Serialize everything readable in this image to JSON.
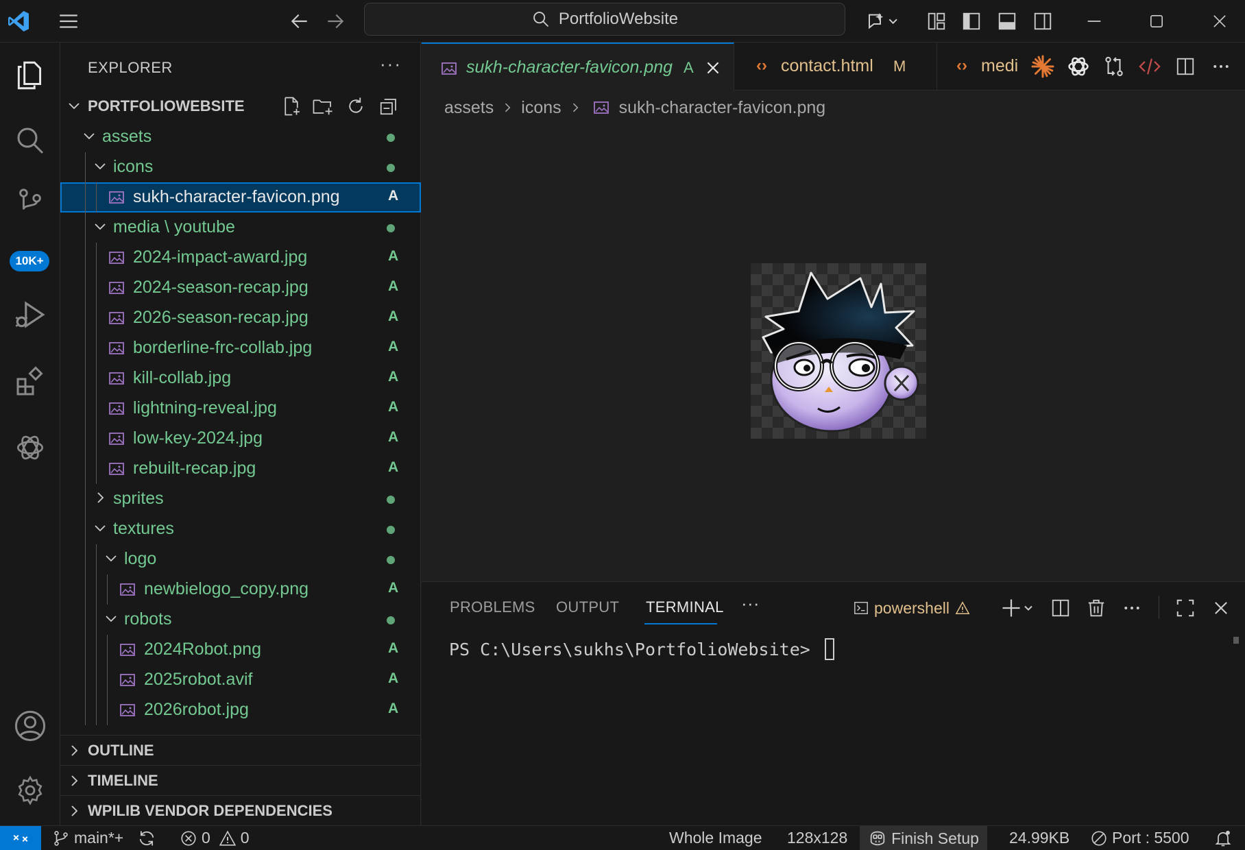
{
  "titlebar": {
    "search_text": "PortfolioWebsite"
  },
  "activitybar": {
    "scm_badge": "10K+"
  },
  "explorer": {
    "title": "EXPLORER",
    "more": "···",
    "folder": "PORTFOLIOWEBSITE",
    "tree": [
      {
        "name": "assets",
        "kind": "folder",
        "expanded": true,
        "status": "dot"
      },
      {
        "name": "icons",
        "kind": "folder",
        "expanded": true,
        "status": "dot"
      },
      {
        "name": "sukh-character-favicon.png",
        "kind": "image",
        "status": "A",
        "selected": true
      },
      {
        "name": "media \\ youtube",
        "kind": "folder",
        "expanded": true,
        "status": "dot"
      },
      {
        "name": "2024-impact-award.jpg",
        "kind": "image",
        "status": "A"
      },
      {
        "name": "2024-season-recap.jpg",
        "kind": "image",
        "status": "A"
      },
      {
        "name": "2026-season-recap.jpg",
        "kind": "image",
        "status": "A"
      },
      {
        "name": "borderline-frc-collab.jpg",
        "kind": "image",
        "status": "A"
      },
      {
        "name": "kill-collab.jpg",
        "kind": "image",
        "status": "A"
      },
      {
        "name": "lightning-reveal.jpg",
        "kind": "image",
        "status": "A"
      },
      {
        "name": "low-key-2024.jpg",
        "kind": "image",
        "status": "A"
      },
      {
        "name": "rebuilt-recap.jpg",
        "kind": "image",
        "status": "A"
      },
      {
        "name": "sprites",
        "kind": "folder",
        "expanded": false,
        "status": "dot"
      },
      {
        "name": "textures",
        "kind": "folder",
        "expanded": true,
        "status": "dot"
      },
      {
        "name": "logo",
        "kind": "folder",
        "expanded": true,
        "status": "dot"
      },
      {
        "name": "newbielogo_copy.png",
        "kind": "image",
        "status": "A"
      },
      {
        "name": "robots",
        "kind": "folder",
        "expanded": true,
        "status": "dot"
      },
      {
        "name": "2024Robot.png",
        "kind": "image",
        "status": "A"
      },
      {
        "name": "2025robot.avif",
        "kind": "image",
        "status": "A"
      },
      {
        "name": "2026robot.jpg",
        "kind": "image",
        "status": "A"
      }
    ],
    "sections": [
      "OUTLINE",
      "TIMELINE",
      "WPILIB VENDOR DEPENDENCIES"
    ]
  },
  "tabs": [
    {
      "name": "sukh-character-favicon.png",
      "status": "A",
      "active": true
    },
    {
      "name": "contact.html",
      "status": "M"
    },
    {
      "name": "medi"
    }
  ],
  "breadcrumbs": [
    "assets",
    "icons",
    "sukh-character-favicon.png"
  ],
  "panel": {
    "tabs": [
      "PROBLEMS",
      "OUTPUT",
      "TERMINAL"
    ],
    "more": "···",
    "shell": "powershell",
    "prompt": "PS C:\\Users\\sukhs\\PortfolioWebsite> "
  },
  "statusbar": {
    "branch": "main*+",
    "errors": "0",
    "warnings": "0",
    "zoom": "Whole Image",
    "dimensions": "128x128",
    "finish_setup": "Finish Setup",
    "size": "24.99KB",
    "port": "Port : 5500"
  },
  "colors": {
    "accent": "#0078d4",
    "added": "#73c991",
    "modified": "#e2c08d",
    "html_icon": "#e37933",
    "image_icon": "#a074c4"
  }
}
